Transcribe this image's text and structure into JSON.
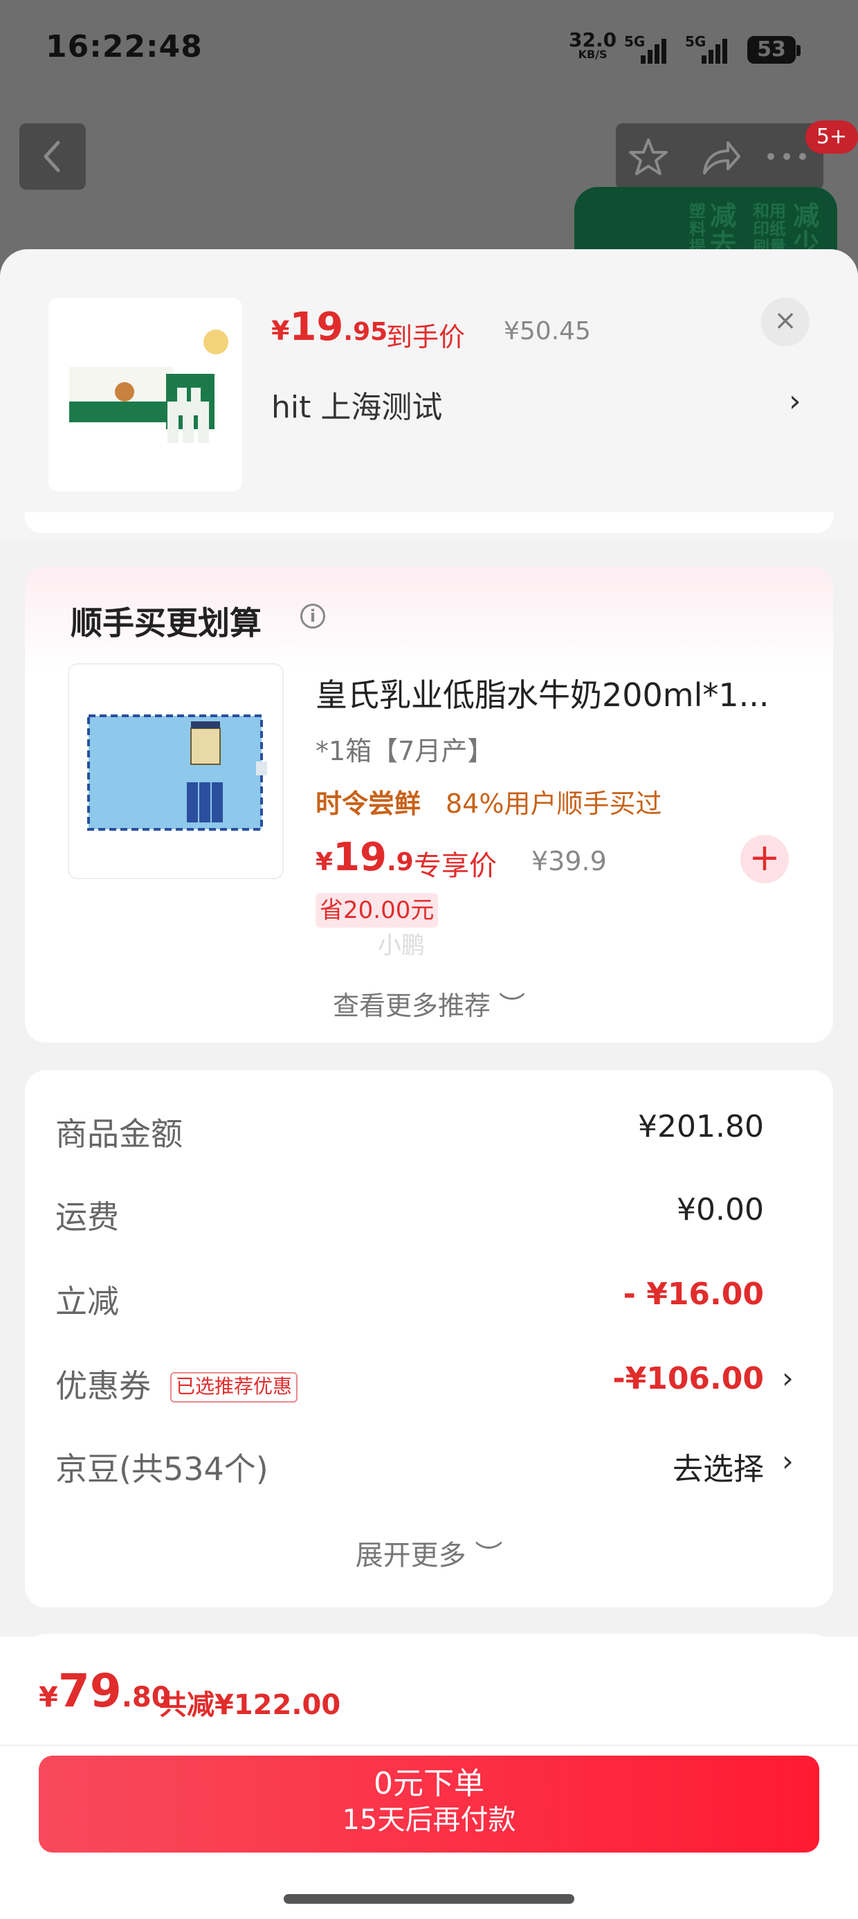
{
  "status_bar": {
    "time": "16:22:48",
    "net_speed": "32.0",
    "net_unit": "KB/S",
    "signal_label_1": "5G",
    "signal_label_2": "5G",
    "battery": "53"
  },
  "nav": {
    "back_icon": "chevron-left-icon",
    "favorite_icon": "star-icon",
    "share_icon": "share-icon",
    "more_icon": "more-dots-icon",
    "badge": "5+"
  },
  "background_banner": {
    "line1": "塑料提",
    "line2": "减去",
    "line3": "和用印纸刷量",
    "line4": "减少"
  },
  "product": {
    "price_symbol": "¥",
    "price_int": "19",
    "price_dec": ".95",
    "price_label": "到手价",
    "original_price": "¥50.45",
    "address": "hit  上海测试",
    "address_arrow": "›",
    "close_label": "×"
  },
  "recommend": {
    "title": "顺手买更划算",
    "info_icon": "info-icon",
    "item": {
      "name": "皇氏乳业低脂水牛奶200ml*1...",
      "spec": "*1箱【7月产】",
      "tag": "时令尝鲜",
      "buyers": "84%用户顺手买过",
      "price_symbol": "¥",
      "price_int": "19",
      "price_dec": ".9",
      "price_label": "专享价",
      "original_price": "¥39.9",
      "add_label": "+",
      "save_label": "省20.00元"
    },
    "watermark": "小鹏",
    "more": "查看更多推荐 ︶"
  },
  "summary": {
    "rows": [
      {
        "label": "商品金额",
        "value": "¥201.80"
      },
      {
        "label": "运费",
        "value": "¥0.00"
      },
      {
        "label": "立减",
        "value": "- ¥16.00"
      },
      {
        "label": "优惠券",
        "tag": "已选推荐优惠",
        "value": "-¥106.00",
        "arrow": "›"
      },
      {
        "label": "京豆(共534个)",
        "value": "去选择",
        "arrow": "›"
      }
    ],
    "expand": "展开更多 ︶"
  },
  "footer": {
    "price_symbol": "¥",
    "price_int": "79",
    "price_dec": ".80",
    "reduced": "共减¥122.00",
    "button_line1": "0元下单",
    "button_line2": "15天后再付款"
  },
  "colors": {
    "accent_red": "#e12c2c",
    "button_gradient_start": "#f84a5c",
    "button_gradient_end": "#ff1a32",
    "banner_green": "#0e4f31"
  }
}
